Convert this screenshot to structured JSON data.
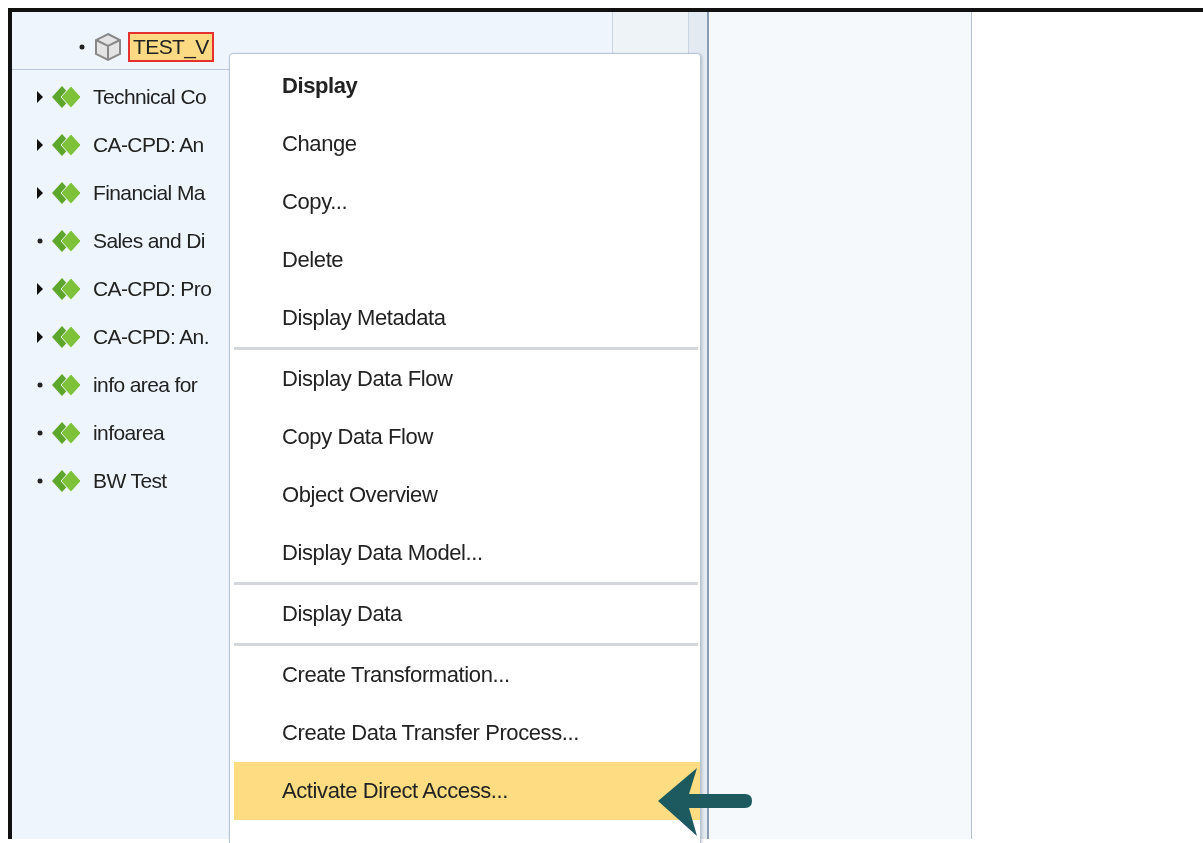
{
  "tree": {
    "items": [
      {
        "label": "TEST_V",
        "kind": "object",
        "expandable": false,
        "selected": true
      },
      {
        "label": "Technical Co",
        "kind": "infoarea",
        "expandable": true,
        "selected": false
      },
      {
        "label": "CA-CPD: An",
        "kind": "infoarea",
        "expandable": true,
        "selected": false
      },
      {
        "label": "Financial Ma",
        "kind": "infoarea",
        "expandable": true,
        "selected": false
      },
      {
        "label": "Sales and Di",
        "kind": "infoarea",
        "expandable": false,
        "selected": false
      },
      {
        "label": "CA-CPD: Pro",
        "kind": "infoarea",
        "expandable": true,
        "selected": false
      },
      {
        "label": "CA-CPD: An.",
        "kind": "infoarea",
        "expandable": true,
        "selected": false
      },
      {
        "label": "info area for",
        "kind": "infoarea",
        "expandable": false,
        "selected": false
      },
      {
        "label": "infoarea",
        "kind": "infoarea",
        "expandable": false,
        "selected": false
      },
      {
        "label": "BW Test",
        "kind": "infoarea",
        "expandable": false,
        "selected": false
      }
    ]
  },
  "context_menu": {
    "groups": [
      {
        "items": [
          {
            "label": "Display",
            "default": true,
            "selected": false
          },
          {
            "label": "Change",
            "default": false,
            "selected": false
          },
          {
            "label": "Copy...",
            "default": false,
            "selected": false
          },
          {
            "label": "Delete",
            "default": false,
            "selected": false
          },
          {
            "label": "Display Metadata",
            "default": false,
            "selected": false
          }
        ]
      },
      {
        "items": [
          {
            "label": "Display Data Flow",
            "default": false,
            "selected": false
          },
          {
            "label": "Copy Data Flow",
            "default": false,
            "selected": false
          },
          {
            "label": "Object Overview",
            "default": false,
            "selected": false
          },
          {
            "label": "Display Data Model...",
            "default": false,
            "selected": false
          }
        ]
      },
      {
        "items": [
          {
            "label": "Display Data",
            "default": false,
            "selected": false
          }
        ]
      },
      {
        "items": [
          {
            "label": "Create Transformation...",
            "default": false,
            "selected": false
          },
          {
            "label": "Create Data Transfer Process...",
            "default": false,
            "selected": false
          },
          {
            "label": "Activate Direct Access...",
            "default": false,
            "selected": true
          }
        ]
      }
    ]
  }
}
